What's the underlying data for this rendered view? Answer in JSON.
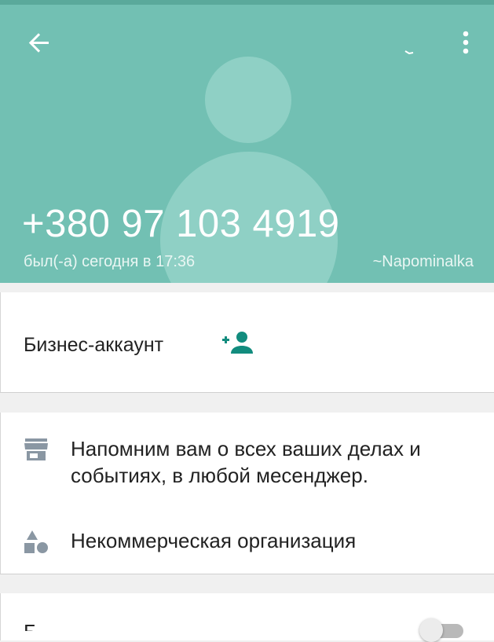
{
  "header": {
    "phone": "+380 97 103 4919",
    "last_seen": "был(-а) сегодня в 17:36",
    "push_name": "~Napominalka",
    "back_icon": "arrow-back-icon",
    "menu_icon": "more-vert-icon",
    "background_color": "#72c0b3"
  },
  "business": {
    "label": "Бизнес-аккаунт",
    "add_icon": "person-add-icon",
    "accent_color": "#128c7e"
  },
  "details": {
    "description": "Напомним вам о всех ваших делах и событиях, в любой месенджер.",
    "description_icon": "store-icon",
    "category": "Некоммерческая организация",
    "category_icon": "category-shapes-icon"
  },
  "settings": {
    "label": "Б",
    "toggle_state": "off"
  }
}
